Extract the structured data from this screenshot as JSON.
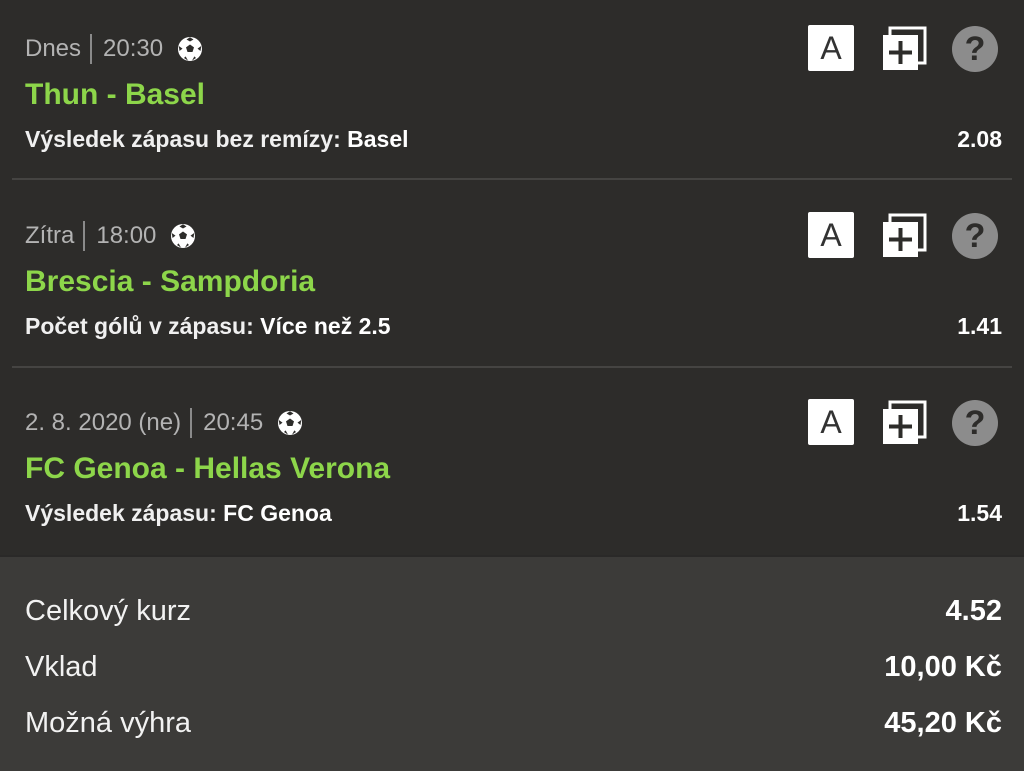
{
  "bets": [
    {
      "day": "Dnes",
      "time": "20:30",
      "sport_icon": "soccer-ball-icon",
      "match": "Thun - Basel",
      "market": "Výsledek zápasu bez remízy:",
      "pick": "Basel",
      "odds": "2.08"
    },
    {
      "day": "Zítra",
      "time": "18:00",
      "sport_icon": "soccer-ball-icon",
      "match": "Brescia - Sampdoria",
      "market": "Počet gólů v zápasu:",
      "pick": "Více než 2.5",
      "odds": "1.41"
    },
    {
      "day": "2. 8. 2020 (ne)",
      "time": "20:45",
      "sport_icon": "soccer-ball-icon",
      "match": "FC Genoa - Hellas Verona",
      "market": "Výsledek zápasu:",
      "pick": "FC Genoa",
      "odds": "1.54"
    }
  ],
  "icons": {
    "a_label": "A",
    "help_label": "?"
  },
  "summary": {
    "total_odds_label": "Celkový kurz",
    "total_odds_value": "4.52",
    "stake_label": "Vklad",
    "stake_value": "10,00 Kč",
    "win_label": "Možná výhra",
    "win_value": "45,20 Kč"
  },
  "colors": {
    "background": "#2d2c2a",
    "summary_background": "#3c3b39",
    "match_green": "#8dd64a",
    "help_grey": "#8c8c8c"
  }
}
